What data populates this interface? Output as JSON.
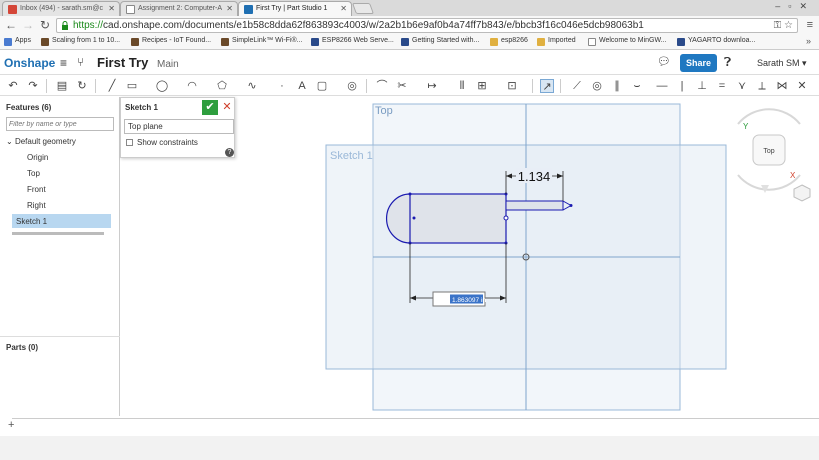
{
  "browser": {
    "tabs": [
      {
        "label": "Inbox (494) - sarath.sm@c",
        "favicon_color": "#d44638"
      },
      {
        "label": "Assignment 2: Computer-A",
        "favicon_color": "#888888"
      },
      {
        "label": "First Try | Part Studio 1",
        "favicon_color": "#1f6fb2",
        "active": true
      }
    ],
    "url_https": "https://",
    "url_rest": "cad.onshape.com/documents/e1b58c8dda62f863893c4003/w/2a2b1b6e9af0b4a74ff7b843/e/bbcb3f16c046e5dcb98063b1",
    "bookmarks": [
      {
        "label": "Apps",
        "color": "#4a7bd0"
      },
      {
        "label": "Scaling from 1 to 10...",
        "color": "#6b4a2a"
      },
      {
        "label": "Recipes - IoT Found...",
        "color": "#6b4a2a"
      },
      {
        "label": "SimpleLink™ Wi-Fi®...",
        "color": "#6b4a2a"
      },
      {
        "label": "ESP8266 Web Serve...",
        "color": "#2a4a8a"
      },
      {
        "label": "Getting Started with...",
        "color": "#2a4a8a"
      },
      {
        "label": "esp8266",
        "color": "#e0b040"
      },
      {
        "label": "Imported",
        "color": "#e0b040"
      },
      {
        "label": "Welcome to MinGW...",
        "color": "#888888"
      },
      {
        "label": "YAGARTO downloa...",
        "color": "#2a4a8a"
      }
    ]
  },
  "header": {
    "logo": "Onshape",
    "title": "First Try",
    "branch": "Main",
    "share_label": "Share",
    "user": "Sarath SM ▾",
    "accent": "#1f78c1"
  },
  "features": {
    "title": "Features (6)",
    "filter_placeholder": "Filter by name or type",
    "group": "Default geometry",
    "items": [
      "Origin",
      "Top",
      "Front",
      "Right"
    ],
    "selected": "Sketch 1",
    "parts_title": "Parts (0)"
  },
  "sketch_dialog": {
    "title": "Sketch 1",
    "plane": "Top plane",
    "show_constraints": "Show constraints",
    "ok_color": "#2e9e3e",
    "cancel_color": "#d0402b"
  },
  "canvas": {
    "plane_label": "Top",
    "sketch_label": "Sketch 1",
    "dimension_1": "1.134",
    "dimension_2": "1.863097 in",
    "viewcube_label": "Top",
    "sketch_color": "#1a1ab0",
    "plane_color": "#9ab8d8"
  }
}
